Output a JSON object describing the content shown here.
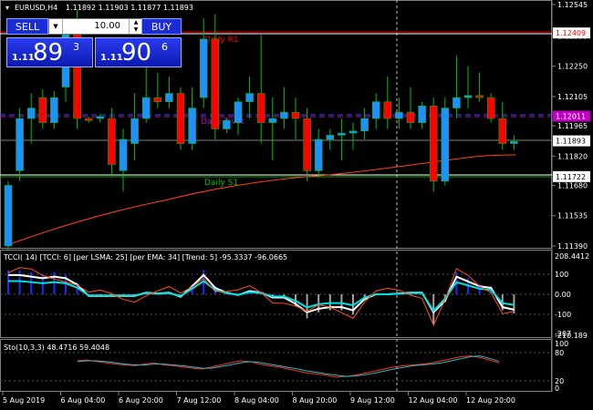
{
  "chart": {
    "symbol_label": "EURUSD,H4",
    "ohlc_label": "1.11892 1.11903 1.11877 1.11893"
  },
  "trade_panel": {
    "sell_label": "SELL",
    "buy_label": "BUY",
    "lot_value": "10.00",
    "sell_price": {
      "prefix": "1.11",
      "big": "89",
      "sup": "3"
    },
    "buy_price": {
      "prefix": "1.11",
      "big": "90",
      "sup": "6"
    }
  },
  "price_axis": {
    "labels": [
      "1.12545",
      "1.12395",
      "1.12250",
      "1.12105",
      "1.11965",
      "1.11820",
      "1.11680",
      "1.11535",
      "1.11390"
    ],
    "tags": [
      {
        "value": "1.12409",
        "color": "#ffffff",
        "text_color": "#ff0000"
      },
      {
        "value": "1.12011",
        "color": "#c000c0",
        "text_color": "#ffffff"
      },
      {
        "value": "1.11893",
        "color": "#ffffff",
        "text_color": "#000000"
      },
      {
        "value": "1.11722",
        "color": "#ffffff",
        "text_color": "#000000"
      }
    ]
  },
  "pivot_labels": {
    "r1": "Daily R1",
    "pivot": "Daily Pivot",
    "s1": "Daily S1"
  },
  "cci_panel": {
    "label": "TCCI( 14) [TCCI: 6] [per LSMA: 25] [per EMA: 34] [Trend: 5] -95.3337 -96.0665",
    "axis": [
      "208.4412",
      "100",
      "0.00",
      "-100",
      "-207",
      "-210.189"
    ]
  },
  "sto_panel": {
    "label": "Sto(10,3,3) 48.4716 59.4048",
    "axis": [
      "100",
      "80",
      "20",
      "0"
    ]
  },
  "time_axis": [
    "5 Aug 2019",
    "6 Aug 04:00",
    "6 Aug 20:00",
    "7 Aug 12:00",
    "8 Aug 04:00",
    "8 Aug 20:00",
    "9 Aug 12:00",
    "12 Aug 04:00",
    "12 Aug 20:00"
  ],
  "colors": {
    "bull": "#1e90ff",
    "bear": "#ff0000",
    "grid": "#3a3a3a"
  },
  "chart_data": {
    "type": "candlestick",
    "candles": [
      {
        "o": 1.1139,
        "h": 1.117,
        "l": 1.1137,
        "c": 1.1168
      },
      {
        "o": 1.1175,
        "h": 1.1205,
        "l": 1.117,
        "c": 1.12
      },
      {
        "o": 1.12,
        "h": 1.1212,
        "l": 1.1188,
        "c": 1.1205
      },
      {
        "o": 1.121,
        "h": 1.1214,
        "l": 1.1195,
        "c": 1.1198
      },
      {
        "o": 1.1198,
        "h": 1.1213,
        "l": 1.1195,
        "c": 1.121
      },
      {
        "o": 1.1215,
        "h": 1.1245,
        "l": 1.1208,
        "c": 1.124
      },
      {
        "o": 1.1245,
        "h": 1.1252,
        "l": 1.1195,
        "c": 1.12
      },
      {
        "o": 1.12,
        "h": 1.1201,
        "l": 1.1198,
        "c": 1.1199
      },
      {
        "o": 1.12,
        "h": 1.1202,
        "l": 1.1198,
        "c": 1.1201
      },
      {
        "o": 1.12,
        "h": 1.1205,
        "l": 1.1172,
        "c": 1.1178
      },
      {
        "o": 1.1175,
        "h": 1.1195,
        "l": 1.1165,
        "c": 1.119
      },
      {
        "o": 1.1188,
        "h": 1.1212,
        "l": 1.118,
        "c": 1.12
      },
      {
        "o": 1.12,
        "h": 1.1225,
        "l": 1.1198,
        "c": 1.121
      },
      {
        "o": 1.121,
        "h": 1.1222,
        "l": 1.1205,
        "c": 1.1208
      },
      {
        "o": 1.1208,
        "h": 1.122,
        "l": 1.1205,
        "c": 1.1212
      },
      {
        "o": 1.1212,
        "h": 1.1215,
        "l": 1.1185,
        "c": 1.1188
      },
      {
        "o": 1.1188,
        "h": 1.1215,
        "l": 1.1185,
        "c": 1.1205
      },
      {
        "o": 1.121,
        "h": 1.1248,
        "l": 1.1205,
        "c": 1.1238
      },
      {
        "o": 1.1238,
        "h": 1.125,
        "l": 1.119,
        "c": 1.1195
      },
      {
        "o": 1.1195,
        "h": 1.12,
        "l": 1.1193,
        "c": 1.1199
      },
      {
        "o": 1.1198,
        "h": 1.121,
        "l": 1.1192,
        "c": 1.1208
      },
      {
        "o": 1.1208,
        "h": 1.122,
        "l": 1.12,
        "c": 1.1212
      },
      {
        "o": 1.1212,
        "h": 1.124,
        "l": 1.1188,
        "c": 1.1198
      },
      {
        "o": 1.1198,
        "h": 1.121,
        "l": 1.118,
        "c": 1.12
      },
      {
        "o": 1.12,
        "h": 1.1215,
        "l": 1.1195,
        "c": 1.1203
      },
      {
        "o": 1.1203,
        "h": 1.121,
        "l": 1.119,
        "c": 1.12
      },
      {
        "o": 1.12,
        "h": 1.1205,
        "l": 1.117,
        "c": 1.1175
      },
      {
        "o": 1.1175,
        "h": 1.1195,
        "l": 1.1172,
        "c": 1.119
      },
      {
        "o": 1.119,
        "h": 1.1195,
        "l": 1.1185,
        "c": 1.1192
      },
      {
        "o": 1.1192,
        "h": 1.12,
        "l": 1.118,
        "c": 1.1193
      },
      {
        "o": 1.1193,
        "h": 1.1198,
        "l": 1.1185,
        "c": 1.1194
      },
      {
        "o": 1.1194,
        "h": 1.1205,
        "l": 1.119,
        "c": 1.12
      },
      {
        "o": 1.12,
        "h": 1.1212,
        "l": 1.1195,
        "c": 1.1208
      },
      {
        "o": 1.1208,
        "h": 1.122,
        "l": 1.1195,
        "c": 1.12
      },
      {
        "o": 1.12,
        "h": 1.121,
        "l": 1.1195,
        "c": 1.1203
      },
      {
        "o": 1.1203,
        "h": 1.1215,
        "l": 1.1195,
        "c": 1.1198
      },
      {
        "o": 1.1198,
        "h": 1.1208,
        "l": 1.1195,
        "c": 1.1206
      },
      {
        "o": 1.1206,
        "h": 1.121,
        "l": 1.1165,
        "c": 1.117
      },
      {
        "o": 1.117,
        "h": 1.121,
        "l": 1.1168,
        "c": 1.1205
      },
      {
        "o": 1.1205,
        "h": 1.123,
        "l": 1.12,
        "c": 1.121
      },
      {
        "o": 1.121,
        "h": 1.1225,
        "l": 1.1205,
        "c": 1.1211
      },
      {
        "o": 1.1211,
        "h": 1.1222,
        "l": 1.1208,
        "c": 1.121
      },
      {
        "o": 1.121,
        "h": 1.1212,
        "l": 1.1198,
        "c": 1.12
      },
      {
        "o": 1.12,
        "h": 1.1208,
        "l": 1.1185,
        "c": 1.1188
      },
      {
        "o": 1.1188,
        "h": 1.1192,
        "l": 1.1185,
        "c": 1.1189
      }
    ]
  }
}
